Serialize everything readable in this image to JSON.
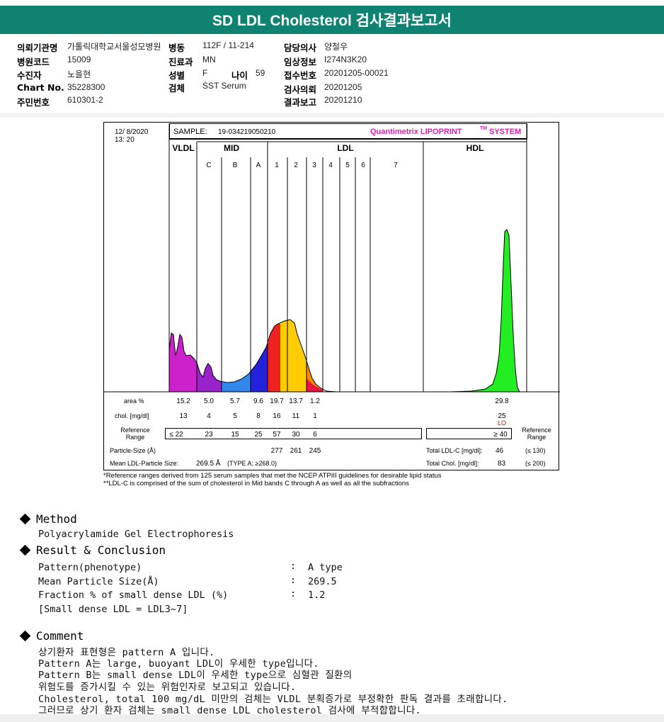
{
  "report_title": "SD LDL Cholesterol 검사결과보고서",
  "patient": {
    "fields": [
      {
        "label": "의뢰기관명",
        "value": "가톨릭대학교서울성모병원"
      },
      {
        "label": "병원코드",
        "value": "15009"
      },
      {
        "label": "수진자",
        "value": "노을현"
      },
      {
        "label": "Chart No.",
        "value": "35228300"
      },
      {
        "label": "주민번호",
        "value": "610301-2"
      },
      {
        "label": "병동",
        "value": "112F / 11-214"
      },
      {
        "label": "진료과",
        "value": "MN"
      },
      {
        "label": "성별",
        "value": "F"
      },
      {
        "label": "나이",
        "value": "59"
      },
      {
        "label": "검체",
        "value": "SST Serum"
      },
      {
        "label": "담당의사",
        "value": "양철우"
      },
      {
        "label": "임상정보",
        "value": "I274N3K20"
      },
      {
        "label": "접수번호",
        "value": "20201205-00021"
      },
      {
        "label": "검사의뢰",
        "value": "20201205"
      },
      {
        "label": "결과보고",
        "value": "20201210"
      }
    ]
  },
  "chart_data": {
    "type": "area",
    "date": "12/  8/2020",
    "time": "13: 20",
    "sample_label": "SAMPLE:",
    "sample_id": "19-034219050210",
    "brand": "Quantimetrix LIPOPRINT",
    "brand_sup": "TM",
    "brand_tail": "SYSTEM",
    "groups": [
      "VLDL",
      "MID",
      "LDL",
      "HDL"
    ],
    "bands": [
      "C",
      "B",
      "A",
      "1",
      "2",
      "3",
      "4",
      "5",
      "6",
      "7"
    ],
    "rows": {
      "area_label": "area %",
      "area": [
        "15.2",
        "5.0",
        "5.7",
        "9.6",
        "19.7",
        "13.7",
        "1.2"
      ],
      "hdl_area": "29.8",
      "chol_label": "chol. [mg/dl]",
      "chol": [
        "13",
        "4",
        "5",
        "8",
        "16",
        "11",
        "1"
      ],
      "hdl_chol": "25",
      "hdl_flag": "LO",
      "ref_label": [
        "Reference",
        "Range"
      ],
      "ref": [
        "≤ 22",
        "23",
        "15",
        "25",
        "57",
        "30",
        "6"
      ],
      "hdl_ref": "≥ 40",
      "ref_label_right": [
        "Reference",
        "Range"
      ],
      "particle_label": "Particle-Size (Å)",
      "particle": [
        "277",
        "261",
        "245"
      ],
      "total_ldl_label": "Total LDL-C [mg/dl]:",
      "total_ldl": "46",
      "total_ldl_ref": "(≤ 130)",
      "mean_label": "Mean LDL-Particle Size:",
      "mean_value": "269.5 Å",
      "mean_type": "(TYPE A; ≥268.0)",
      "total_chol_label": "Total Chol. [mg/dl]:",
      "total_chol": "83",
      "total_chol_ref": "(≤ 200)"
    },
    "colors": {
      "vldl": "#cc22cc",
      "c": "#9922cc",
      "b": "#3388ee",
      "a": "#2222dd",
      "ldl1": "#ee2222",
      "ldl2": "#ffcc00",
      "ldl3": "#ff8800",
      "ldl4": "#ee1144",
      "hdl": "#22ee22",
      "brand": "#dd22aa"
    }
  },
  "footnotes": [
    "*Reference ranges derived from 125 serum samples that met the NCEP ATPIII guidelines for desirable lipid status",
    "**LDL-C is comprised of the sum of cholesterol in Mid bands C through A as well as all the subfractions"
  ],
  "method": {
    "title": "Method",
    "text": "Polyacrylamide Gel Electrophoresis"
  },
  "result": {
    "title": "Result & Conclusion",
    "lines": [
      {
        "label": "Pattern(phenotype)",
        "sep": ":",
        "value": "A type"
      },
      {
        "label": "Mean Particle Size(Å)",
        "sep": ":",
        "value": "269.5"
      },
      {
        "label": "Fraction % of small dense LDL (%)",
        "sep": ":",
        "value": "1.2"
      }
    ],
    "note": "[Small dense LDL = LDL3~7]"
  },
  "comment": {
    "title": "Comment",
    "lines": [
      "상기환자 표현형은 pattern A 입니다.",
      "Pattern A는 large, buoyant LDL이 우세한 type입니다.",
      "Pattern B는 small dense LDL이 우세한 type으로 심혈관 질환의",
      "위험도를 증가시킬 수 있는 위험인자로 보고되고 있습니다.",
      "Cholesterol, total 100 mg/dL 미만의 검체는 VLDL 분획증가로 부정확한 판독 결과를 초래합니다.",
      "그러므로 상기 환자 검체는 small dense LDL cholesterol 검사에 부적합합니다."
    ]
  }
}
